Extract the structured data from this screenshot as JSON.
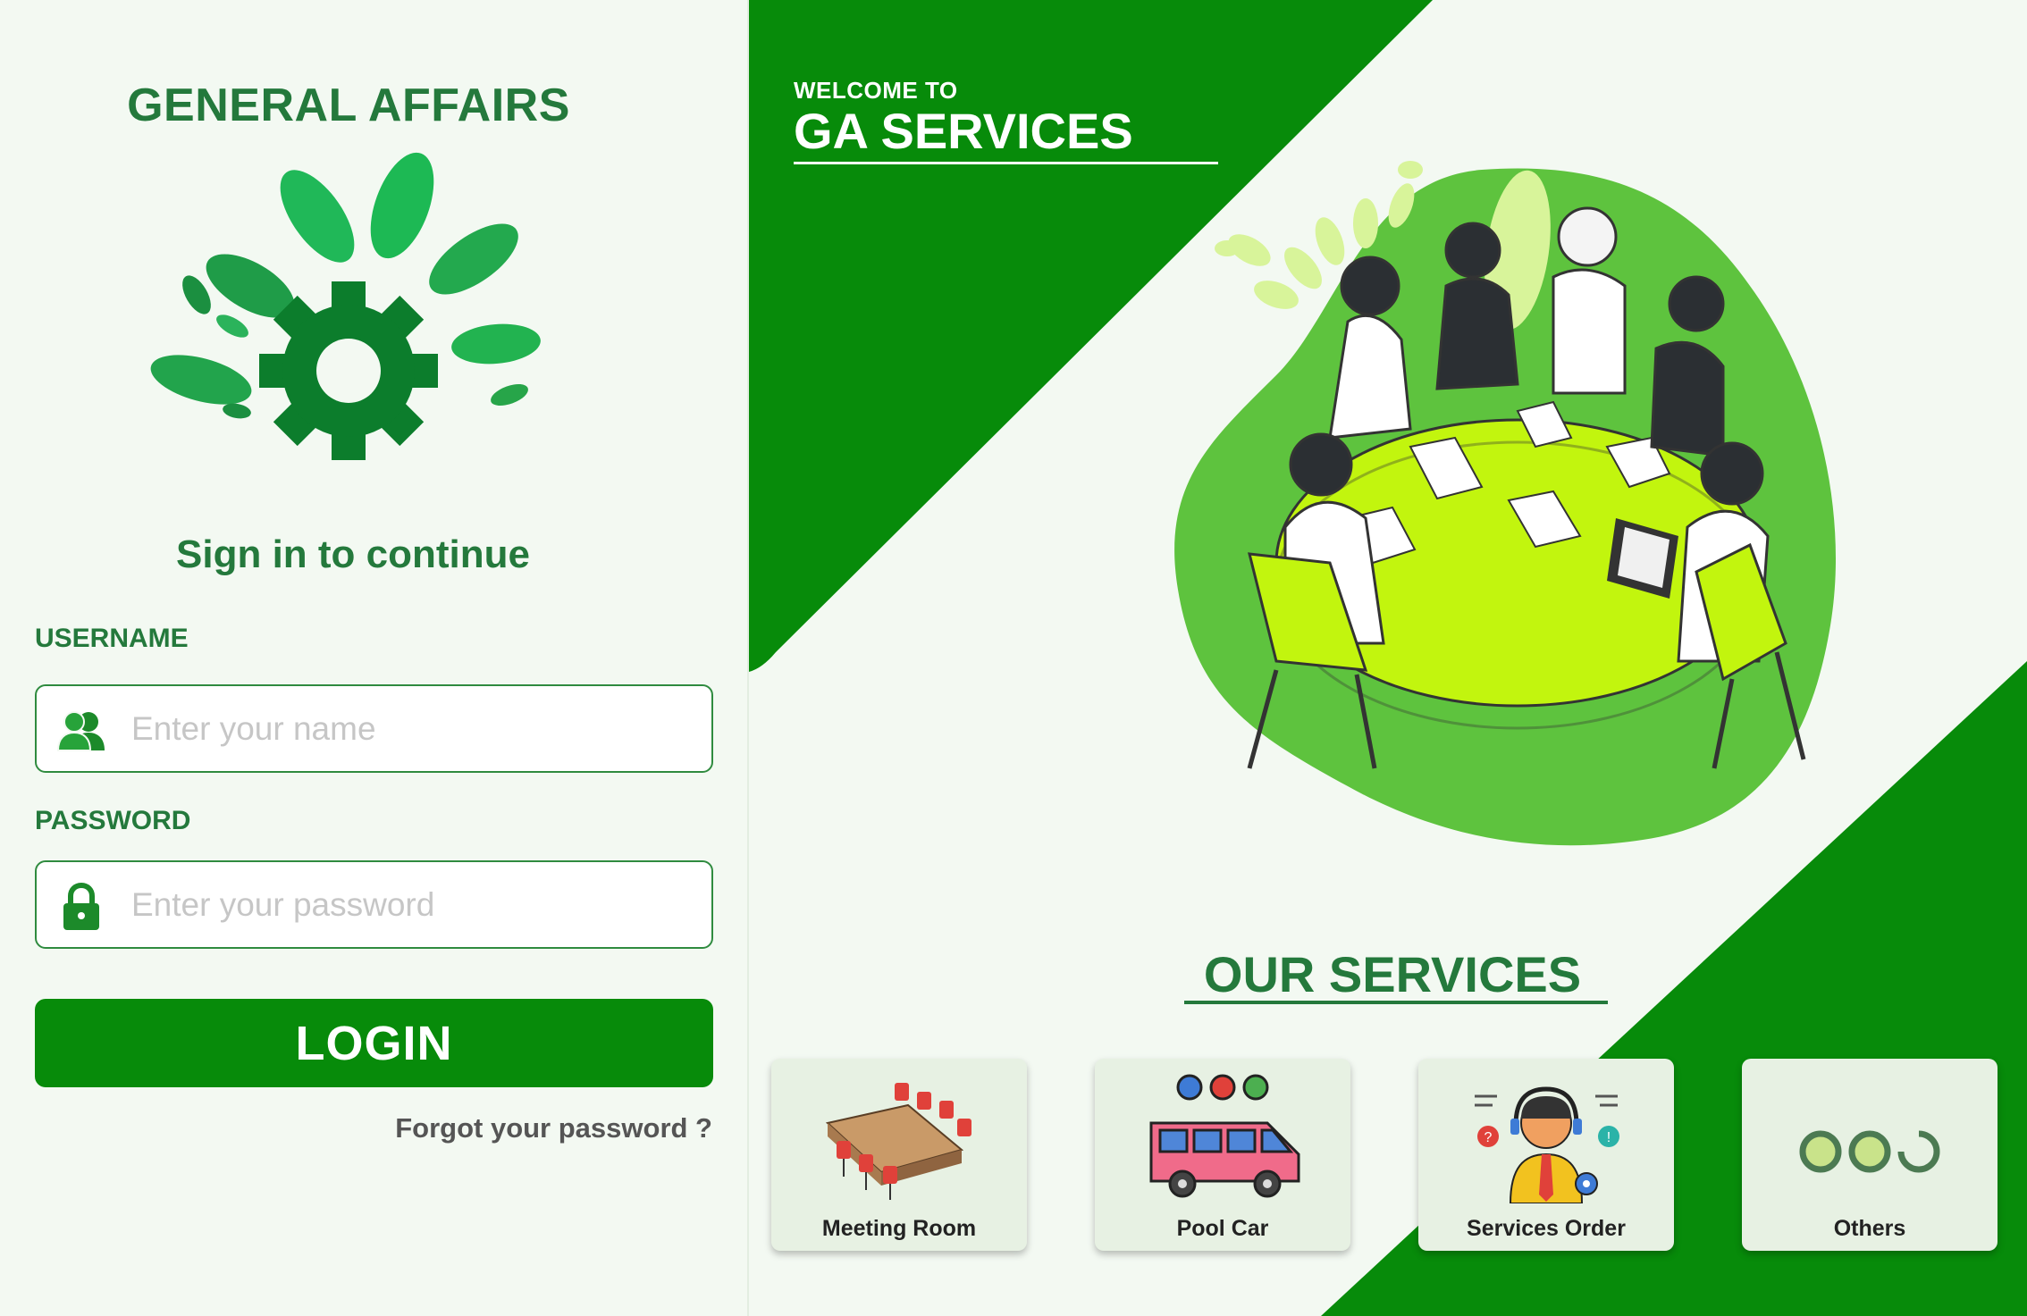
{
  "login": {
    "brand_title": "GENERAL AFFAIRS",
    "signin_heading": "Sign in to continue",
    "username_label": "USERNAME",
    "username_placeholder": "Enter your name",
    "username_icon": "users-icon",
    "password_label": "PASSWORD",
    "password_placeholder": "Enter your password",
    "password_icon": "lock-icon",
    "login_button": "LOGIN",
    "forgot_link": "Forgot your password ?"
  },
  "hero": {
    "welcome": "WELCOME TO",
    "title": "GA SERVICES",
    "services_heading": "OUR SERVICES"
  },
  "services": [
    {
      "label": "Meeting Room",
      "icon": "meeting-room-icon"
    },
    {
      "label": "Pool Car",
      "icon": "pool-car-icon"
    },
    {
      "label": "Services Order",
      "icon": "services-order-icon"
    },
    {
      "label": "Others",
      "icon": "others-icon"
    }
  ],
  "colors": {
    "brand_green": "#078b0a",
    "text_green": "#24793c",
    "background": "#f3f9f2",
    "card_bg": "#e7f1e3",
    "blob_green": "#5ec33e",
    "table_lime": "#c2f50e"
  }
}
